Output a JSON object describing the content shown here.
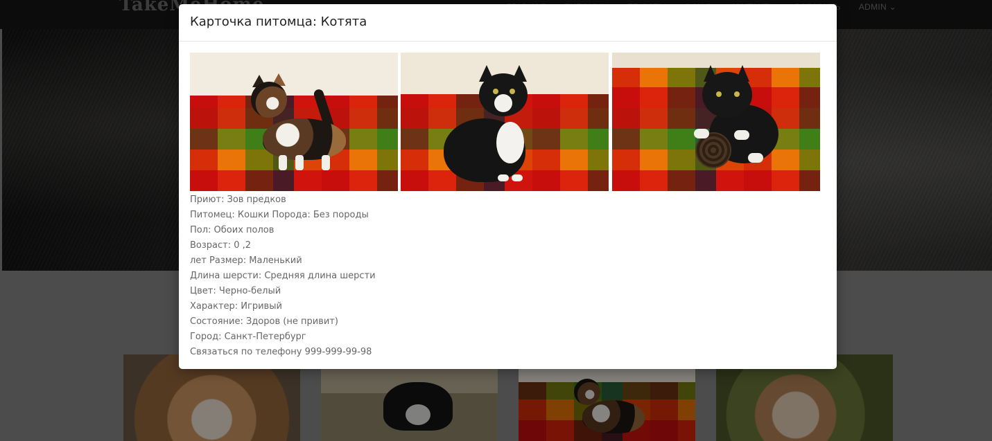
{
  "navbar": {
    "logo": "TakeMeHome",
    "links": [
      "Главная",
      "Питомцы",
      "Приюты",
      "О нас",
      "Контакты",
      "Добавить"
    ],
    "admin_label": "ADMIN",
    "admin_icon": "chevron-down-icon"
  },
  "modal": {
    "title": "Карточка питомца: Котята",
    "photos": [
      {
        "alt": "Трёхцветный котёнок на клетчатом пледе"
      },
      {
        "alt": "Чёрно-белый котёнок сидит на пледе"
      },
      {
        "alt": "Чёрно-белый котёнок играет с мячиком"
      }
    ],
    "info": {
      "shelter": "Приют: Зов предков",
      "pet": "Питомец: Кошки Порода: Без породы",
      "sex": "Пол: Обоих полов",
      "age": "Возраст: 0 ,2",
      "size": "лет Размер: Маленький",
      "coat": "Длина шерсти: Средняя длина шерсти",
      "color": "Цвет: Черно-белый",
      "character": "Характер: Игривый",
      "health": "Состояние: Здоров (не привит)",
      "city": "Город: Санкт-Петербург",
      "contact": "Связаться по телефону 999-999-99-98"
    }
  },
  "background_cards": [
    {
      "name": "corgi-photo"
    },
    {
      "name": "tuxedo-cat-photo"
    },
    {
      "name": "calico-kitten-photo"
    },
    {
      "name": "puppy-photo"
    }
  ],
  "colors": {
    "navbar": "#161616",
    "backdrop": "rgba(0,0,0,0.45)",
    "modal_bg": "#ffffff",
    "text_muted": "#666666"
  }
}
